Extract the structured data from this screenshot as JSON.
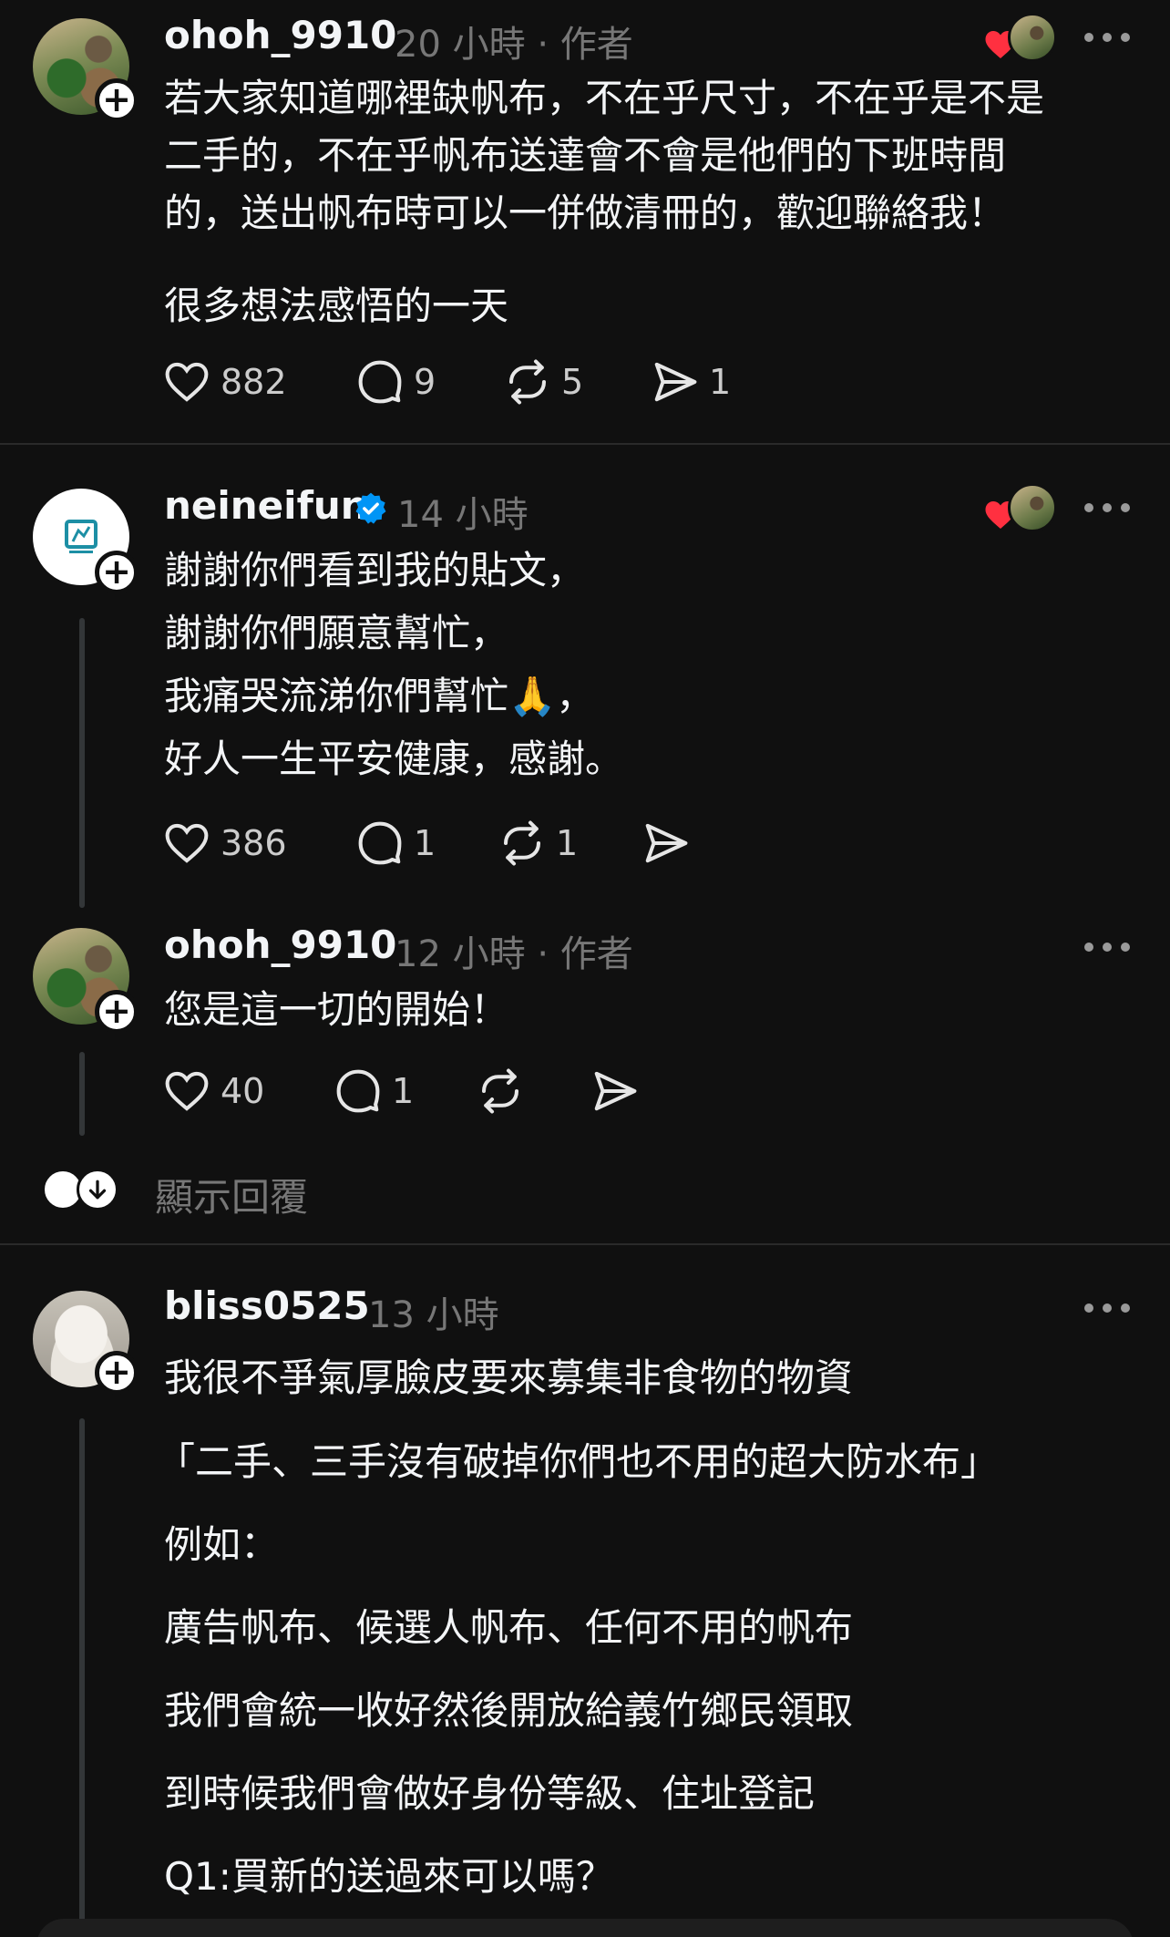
{
  "posts": [
    {
      "username": "ohoh_9910",
      "meta": "20 小時 · 作者",
      "lines": [
        "若大家知道哪裡缺帆布，不在乎尺寸，不在乎是不是",
        "二手的，不在乎帆布送達會不會是他們的下班時間",
        "的，送出帆布時可以一併做清冊的，歡迎聯絡我！"
      ],
      "extra_paragraph": "很多想法感悟的一天",
      "likes": "882",
      "replies": "9",
      "reposts": "5",
      "shares": "1"
    },
    {
      "username": "neineifun",
      "meta": "14 小時",
      "lines": [
        "謝謝你們看到我的貼文，",
        "謝謝你們願意幫忙，",
        "我痛哭流涕你們幫忙🙏，",
        "好人一生平安健康，感謝。"
      ],
      "likes": "386",
      "replies": "1",
      "reposts": "1"
    },
    {
      "username": "ohoh_9910",
      "meta": "12 小時 · 作者",
      "lines": [
        "您是這一切的開始！"
      ],
      "likes": "40",
      "replies": "1"
    },
    {
      "username": "bliss0525",
      "meta": "13 小時",
      "paragraphs": [
        "我很不爭氣厚臉皮要來募集非食物的物資",
        "「二手、三手沒有破掉你們也不用的超大防水布」",
        "例如：",
        "廣告帆布、候選人帆布、任何不用的帆布",
        "我們會統一收好然後開放給義竹鄉民領取",
        "到時候我們會做好身份等級、住址登記",
        "Q1:買新的送過來可以嗎？"
      ]
    }
  ],
  "show_replies": "顯示回覆",
  "colors": {
    "background": "#101010",
    "text": "#f3f5f7",
    "muted": "#777777",
    "heart": "#ff3040",
    "verified": "#0095f6"
  }
}
